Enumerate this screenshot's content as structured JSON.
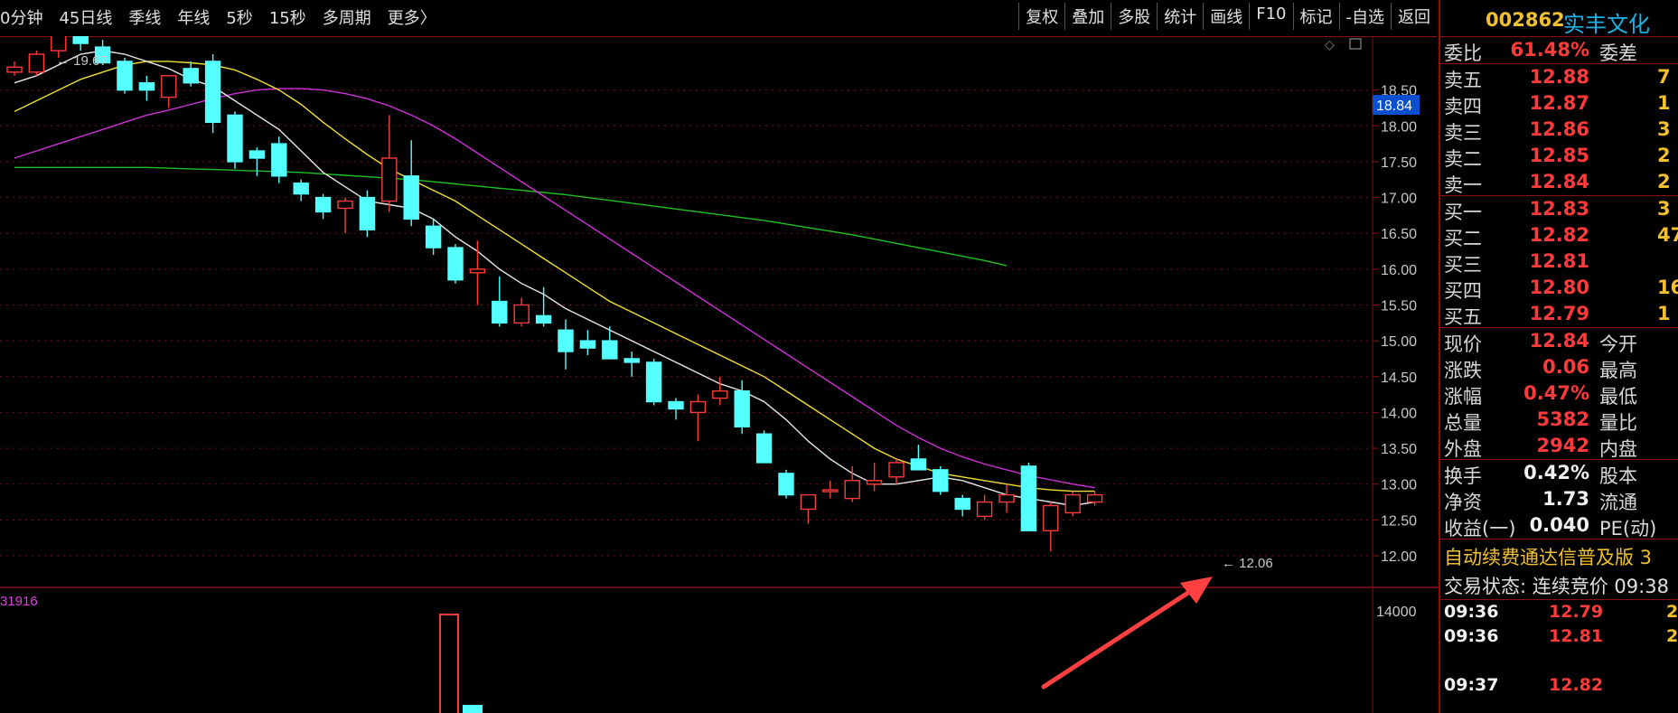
{
  "toolbar": {
    "periods": [
      "0分钟",
      "45日线",
      "季线",
      "年线",
      "5秒",
      "15秒",
      "多周期",
      "更多〉"
    ],
    "actions": [
      "复权",
      "叠加",
      "多股",
      "统计",
      "画线",
      "F10",
      "标记",
      "-自选",
      "返回"
    ]
  },
  "chart": {
    "price_labels": [
      "18.50",
      "18.00",
      "17.50",
      "17.00",
      "16.50",
      "16.00",
      "15.50",
      "15.00",
      "14.50",
      "14.00",
      "13.50",
      "13.00",
      "12.50",
      "12.00"
    ],
    "current_price_tag": "18.84",
    "high_marker": "19.67",
    "low_marker": "12.06",
    "volume_label": "31916",
    "volume_axis_label": "14000",
    "colors": {
      "up": "#ff3a3a",
      "down": "#54ffff",
      "ma5": "#e6e6e6",
      "ma10": "#f0e030",
      "ma20": "#d030d8",
      "ma60": "#20c020",
      "arrow": "#ff4040"
    }
  },
  "chart_data": {
    "type": "candlestick",
    "ylim": [
      11.8,
      19.5
    ],
    "candles": [
      {
        "o": 18.75,
        "h": 18.9,
        "l": 18.7,
        "c": 18.82
      },
      {
        "o": 18.75,
        "h": 19.05,
        "l": 18.7,
        "c": 19.0
      },
      {
        "o": 19.05,
        "h": 19.45,
        "l": 18.95,
        "c": 19.4
      },
      {
        "o": 19.5,
        "h": 19.6,
        "l": 19.05,
        "c": 19.15
      },
      {
        "o": 19.1,
        "h": 19.2,
        "l": 18.85,
        "c": 18.88
      },
      {
        "o": 18.9,
        "h": 18.95,
        "l": 18.45,
        "c": 18.5
      },
      {
        "o": 18.6,
        "h": 18.7,
        "l": 18.35,
        "c": 18.5
      },
      {
        "o": 18.4,
        "h": 18.65,
        "l": 18.25,
        "c": 18.7
      },
      {
        "o": 18.8,
        "h": 18.9,
        "l": 18.55,
        "c": 18.6
      },
      {
        "o": 18.9,
        "h": 19.0,
        "l": 17.9,
        "c": 18.05
      },
      {
        "o": 18.15,
        "h": 18.2,
        "l": 17.4,
        "c": 17.5
      },
      {
        "o": 17.65,
        "h": 17.7,
        "l": 17.3,
        "c": 17.55
      },
      {
        "o": 17.75,
        "h": 17.85,
        "l": 17.2,
        "c": 17.3
      },
      {
        "o": 17.2,
        "h": 17.25,
        "l": 16.95,
        "c": 17.05
      },
      {
        "o": 17.0,
        "h": 17.05,
        "l": 16.7,
        "c": 16.8
      },
      {
        "o": 16.85,
        "h": 17.0,
        "l": 16.5,
        "c": 16.95
      },
      {
        "o": 17.0,
        "h": 17.1,
        "l": 16.45,
        "c": 16.55
      },
      {
        "o": 16.95,
        "h": 18.15,
        "l": 16.8,
        "c": 17.55
      },
      {
        "o": 17.3,
        "h": 17.8,
        "l": 16.6,
        "c": 16.7
      },
      {
        "o": 16.6,
        "h": 16.7,
        "l": 16.2,
        "c": 16.3
      },
      {
        "o": 16.3,
        "h": 16.35,
        "l": 15.8,
        "c": 15.85
      },
      {
        "o": 15.95,
        "h": 16.4,
        "l": 15.5,
        "c": 16.0
      },
      {
        "o": 15.55,
        "h": 15.9,
        "l": 15.2,
        "c": 15.25
      },
      {
        "o": 15.25,
        "h": 15.6,
        "l": 15.2,
        "c": 15.5
      },
      {
        "o": 15.35,
        "h": 15.75,
        "l": 15.2,
        "c": 15.25
      },
      {
        "o": 15.15,
        "h": 15.3,
        "l": 14.6,
        "c": 14.85
      },
      {
        "o": 15.0,
        "h": 15.15,
        "l": 14.8,
        "c": 14.9
      },
      {
        "o": 15.0,
        "h": 15.2,
        "l": 14.75,
        "c": 14.75
      },
      {
        "o": 14.75,
        "h": 14.85,
        "l": 14.5,
        "c": 14.7
      },
      {
        "o": 14.7,
        "h": 14.75,
        "l": 14.1,
        "c": 14.15
      },
      {
        "o": 14.15,
        "h": 14.2,
        "l": 13.9,
        "c": 14.05
      },
      {
        "o": 14.0,
        "h": 14.25,
        "l": 13.6,
        "c": 14.15
      },
      {
        "o": 14.2,
        "h": 14.5,
        "l": 14.1,
        "c": 14.3
      },
      {
        "o": 14.3,
        "h": 14.45,
        "l": 13.7,
        "c": 13.8
      },
      {
        "o": 13.7,
        "h": 13.75,
        "l": 13.3,
        "c": 13.3
      },
      {
        "o": 13.15,
        "h": 13.2,
        "l": 12.8,
        "c": 12.85
      },
      {
        "o": 12.65,
        "h": 12.85,
        "l": 12.45,
        "c": 12.85
      },
      {
        "o": 12.9,
        "h": 13.05,
        "l": 12.8,
        "c": 12.92
      },
      {
        "o": 12.8,
        "h": 13.25,
        "l": 12.75,
        "c": 13.05
      },
      {
        "o": 13.0,
        "h": 13.3,
        "l": 12.9,
        "c": 13.05
      },
      {
        "o": 13.1,
        "h": 13.35,
        "l": 13.0,
        "c": 13.3
      },
      {
        "o": 13.35,
        "h": 13.55,
        "l": 13.2,
        "c": 13.2
      },
      {
        "o": 13.2,
        "h": 13.25,
        "l": 12.85,
        "c": 12.9
      },
      {
        "o": 12.8,
        "h": 12.85,
        "l": 12.55,
        "c": 12.65
      },
      {
        "o": 12.55,
        "h": 12.85,
        "l": 12.5,
        "c": 12.75
      },
      {
        "o": 12.75,
        "h": 13.0,
        "l": 12.6,
        "c": 12.85
      },
      {
        "o": 13.25,
        "h": 13.3,
        "l": 12.35,
        "c": 12.35
      },
      {
        "o": 12.35,
        "h": 12.75,
        "l": 12.06,
        "c": 12.7
      },
      {
        "o": 12.6,
        "h": 12.9,
        "l": 12.55,
        "c": 12.85
      },
      {
        "o": 12.75,
        "h": 12.9,
        "l": 12.7,
        "c": 12.85
      }
    ],
    "ma5": [
      18.6,
      18.7,
      18.85,
      19.0,
      19.05,
      19.0,
      18.9,
      18.8,
      18.65,
      18.55,
      18.35,
      18.15,
      17.95,
      17.65,
      17.35,
      17.15,
      16.95,
      16.9,
      16.85,
      16.7,
      16.45,
      16.25,
      16.0,
      15.8,
      15.65,
      15.45,
      15.3,
      15.15,
      15.0,
      14.85,
      14.7,
      14.55,
      14.4,
      14.3,
      14.15,
      13.9,
      13.6,
      13.35,
      13.15,
      13.0,
      13.0,
      13.05,
      13.1,
      13.05,
      12.95,
      12.85,
      12.8,
      12.75,
      12.7,
      12.75
    ],
    "ma10": [
      18.2,
      18.35,
      18.5,
      18.65,
      18.75,
      18.85,
      18.9,
      18.9,
      18.88,
      18.85,
      18.78,
      18.65,
      18.5,
      18.3,
      18.05,
      17.82,
      17.6,
      17.4,
      17.25,
      17.1,
      16.95,
      16.75,
      16.55,
      16.35,
      16.15,
      15.95,
      15.75,
      15.55,
      15.4,
      15.25,
      15.1,
      14.95,
      14.8,
      14.65,
      14.5,
      14.3,
      14.1,
      13.9,
      13.7,
      13.5,
      13.35,
      13.25,
      13.15,
      13.1,
      13.05,
      13.0,
      12.95,
      12.92,
      12.9,
      12.9
    ],
    "ma20": [
      17.55,
      17.65,
      17.75,
      17.85,
      17.95,
      18.05,
      18.15,
      18.22,
      18.3,
      18.38,
      18.45,
      18.5,
      18.52,
      18.52,
      18.5,
      18.45,
      18.38,
      18.28,
      18.15,
      18.0,
      17.82,
      17.62,
      17.42,
      17.22,
      17.02,
      16.82,
      16.62,
      16.42,
      16.22,
      16.02,
      15.82,
      15.62,
      15.42,
      15.22,
      15.02,
      14.82,
      14.62,
      14.42,
      14.22,
      14.02,
      13.82,
      13.65,
      13.5,
      13.38,
      13.28,
      13.2,
      13.12,
      13.06,
      13.0,
      12.95
    ],
    "ma60": [
      17.42,
      17.42,
      17.42,
      17.42,
      17.42,
      17.42,
      17.42,
      17.41,
      17.4,
      17.39,
      17.38,
      17.37,
      17.36,
      17.35,
      17.33,
      17.31,
      17.29,
      17.27,
      17.25,
      17.22,
      17.19,
      17.16,
      17.13,
      17.1,
      17.07,
      17.04,
      17.0,
      16.96,
      16.92,
      16.88,
      16.84,
      16.8,
      16.76,
      16.72,
      16.68,
      16.63,
      16.58,
      16.53,
      16.48,
      16.42,
      16.36,
      16.3,
      16.24,
      16.18,
      16.12,
      16.05
    ],
    "volume_bar_values": [
      13900,
      12500
    ]
  },
  "panel": {
    "code": "002862",
    "name": "实丰文化",
    "ratio": {
      "label": "委比",
      "value": "61.48%",
      "label2": "委差"
    },
    "sells": [
      {
        "label": "卖五",
        "price": "12.88",
        "vol": "7"
      },
      {
        "label": "卖四",
        "price": "12.87",
        "vol": "1"
      },
      {
        "label": "卖三",
        "price": "12.86",
        "vol": "3"
      },
      {
        "label": "卖二",
        "price": "12.85",
        "vol": "2"
      },
      {
        "label": "卖一",
        "price": "12.84",
        "vol": "2"
      }
    ],
    "buys": [
      {
        "label": "买一",
        "price": "12.83",
        "vol": "3"
      },
      {
        "label": "买二",
        "price": "12.82",
        "vol": "47"
      },
      {
        "label": "买三",
        "price": "12.81",
        "vol": ""
      },
      {
        "label": "买四",
        "price": "12.80",
        "vol": "16"
      },
      {
        "label": "买五",
        "price": "12.79",
        "vol": "1"
      }
    ],
    "stats1": [
      {
        "label": "现价",
        "value": "12.84",
        "label2": "今开"
      },
      {
        "label": "涨跌",
        "value": "0.06",
        "label2": "最高"
      },
      {
        "label": "涨幅",
        "value": "0.47%",
        "label2": "最低"
      },
      {
        "label": "总量",
        "value": "5382",
        "label2": "量比"
      },
      {
        "label": "外盘",
        "value": "2942",
        "label2": "内盘"
      }
    ],
    "stats2": [
      {
        "label": "换手",
        "value": "0.42%",
        "label2": "股本"
      },
      {
        "label": "净资",
        "value": "1.73",
        "label2": "流通"
      },
      {
        "label": "收益(一)",
        "value": "0.040",
        "label2": "PE(动)"
      }
    ],
    "news": "自动续费通达信普及版 3",
    "status": "交易状态: 连续竞价 09:38",
    "ticks": [
      {
        "time": "09:36",
        "price": "12.79",
        "vol": "2"
      },
      {
        "time": "09:36",
        "price": "12.81",
        "vol": "2"
      },
      {
        "time": "",
        "price": "",
        "vol": ""
      },
      {
        "time": "09:37",
        "price": "12.82",
        "vol": ""
      }
    ]
  }
}
